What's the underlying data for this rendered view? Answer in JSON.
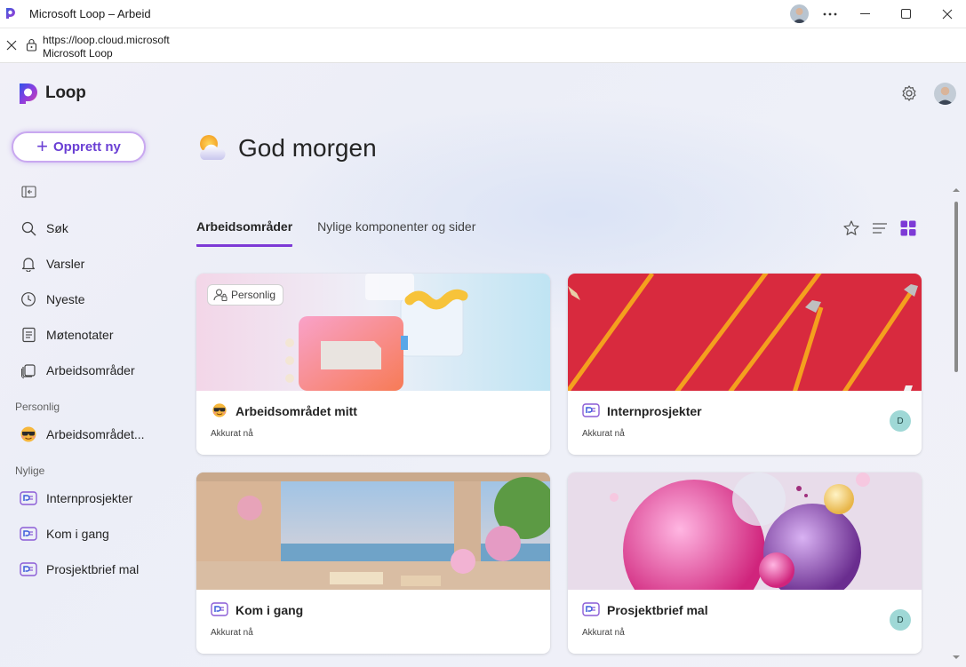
{
  "window": {
    "title": "Microsoft Loop – Arbeid"
  },
  "address": {
    "url": "https://loop.cloud.microsoft",
    "site_name": "Microsoft Loop"
  },
  "app": {
    "logo_text": "Loop",
    "create_label": "Opprett ny",
    "nav": [
      {
        "label": "Søk",
        "icon": "search-icon"
      },
      {
        "label": "Varsler",
        "icon": "bell-icon"
      },
      {
        "label": "Nyeste",
        "icon": "clock-icon"
      },
      {
        "label": "Møtenotater",
        "icon": "notes-icon"
      },
      {
        "label": "Arbeidsområder",
        "icon": "workspaces-icon"
      }
    ],
    "personal_section": "Personlig",
    "personal_items": [
      {
        "label": "Arbeidsområdet...",
        "icon": "sunglasses-emoji-icon"
      }
    ],
    "recent_section": "Nylige",
    "recent_items": [
      {
        "label": "Internprosjekter",
        "icon": "loop-workspace-icon"
      },
      {
        "label": "Kom i gang",
        "icon": "loop-workspace-icon"
      },
      {
        "label": "Prosjektbrief mal",
        "icon": "loop-workspace-icon"
      }
    ]
  },
  "main": {
    "greeting": "God morgen",
    "tabs": [
      {
        "label": "Arbeidsområder",
        "active": true
      },
      {
        "label": "Nylige komponenter og sider",
        "active": false
      }
    ],
    "cards": [
      {
        "title": "Arbeidsområdet mitt",
        "time": "Akkurat nå",
        "badge": "Personlig",
        "avatar": "",
        "cover": "pastel-3d",
        "icon": "sunglasses-emoji-icon"
      },
      {
        "title": "Internprosjekter",
        "time": "Akkurat nå",
        "badge": "",
        "avatar": "D",
        "cover": "red-pencils",
        "icon": "loop-workspace-icon"
      },
      {
        "title": "Kom i gang",
        "time": "Akkurat nå",
        "badge": "",
        "avatar": "",
        "cover": "terrace-sea",
        "icon": "loop-workspace-icon"
      },
      {
        "title": "Prosjektbrief mal",
        "time": "Akkurat nå",
        "badge": "",
        "avatar": "D",
        "cover": "pink-spheres",
        "icon": "loop-workspace-icon"
      }
    ]
  },
  "colors": {
    "accent": "#7d3ad6",
    "create_border": "#c9a8f0",
    "avatar_bg": "#9fd8d6"
  }
}
